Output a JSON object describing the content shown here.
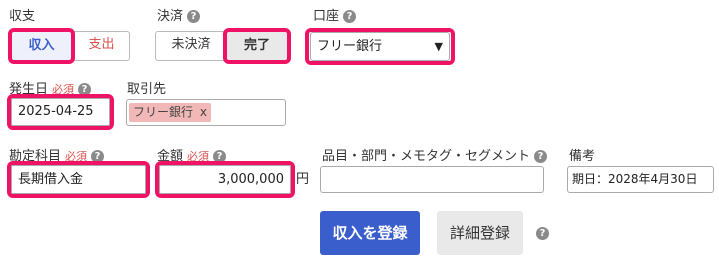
{
  "type": {
    "label": "収支",
    "options": [
      "収入",
      "支出"
    ],
    "selected": "収入"
  },
  "settlement": {
    "label": "決済",
    "options": [
      "未決済",
      "完了"
    ],
    "selected": "完了"
  },
  "account": {
    "label": "口座",
    "value": "フリー銀行"
  },
  "date": {
    "label": "発生日",
    "required": "必須",
    "value": "2025-04-25"
  },
  "partner": {
    "label": "取引先",
    "tag": "フリー銀行",
    "tag_remove": "x"
  },
  "category": {
    "label": "勘定科目",
    "required": "必須",
    "value": "長期借入金"
  },
  "amount": {
    "label": "金額",
    "required": "必須",
    "value": "3,000,000",
    "unit": "円"
  },
  "items": {
    "label": "品目・部門・メモタグ・セグメント",
    "value": ""
  },
  "remarks": {
    "label": "備考",
    "value": "期日：2028年4月30日"
  },
  "actions": {
    "register": "収入を登録",
    "detail": "詳細登録"
  },
  "colors": {
    "highlight": "#f01365",
    "primary": "#3a5fcd",
    "required": "#d9534f",
    "tag_bg": "#f2b8b8"
  },
  "icons": {
    "help": "?"
  }
}
